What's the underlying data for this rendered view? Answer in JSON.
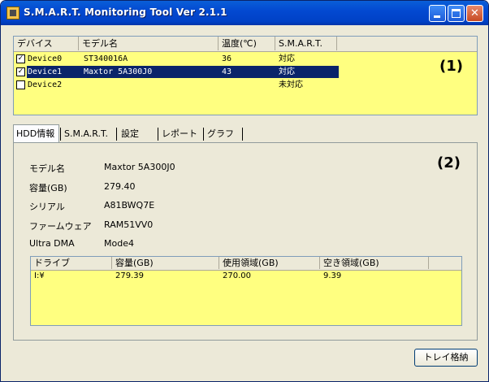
{
  "window": {
    "title": "S.M.A.R.T. Monitoring Tool  Ver 2.1.1",
    "minimize_glyph": "",
    "maximize_glyph": "",
    "close_glyph": "✕"
  },
  "device_list": {
    "columns": [
      "デバイス",
      "モデル名",
      "温度(℃)",
      "S.M.A.R.T."
    ],
    "rows": [
      {
        "checked": true,
        "device": "Device0",
        "model": "ST340016A",
        "temp": "36",
        "smart": "対応",
        "selected": false
      },
      {
        "checked": true,
        "device": "Device1",
        "model": "Maxtor 5A300J0",
        "temp": "43",
        "smart": "対応",
        "selected": true
      },
      {
        "checked": false,
        "device": "Device2",
        "model": "",
        "temp": "",
        "smart": "未対応",
        "selected": false
      }
    ],
    "marker": "(1)"
  },
  "tabs": [
    "HDD情報",
    "S.M.A.R.T.",
    "設定",
    "レポート",
    "グラフ"
  ],
  "hdd_info": {
    "marker": "(2)",
    "fields": [
      {
        "label": "モデル名",
        "value": "Maxtor 5A300J0"
      },
      {
        "label": "容量(GB)",
        "value": "279.40"
      },
      {
        "label": "シリアル",
        "value": "A81BWQ7E"
      },
      {
        "label": "ファームウェア",
        "value": "RAM51VV0"
      },
      {
        "label": "Ultra DMA",
        "value": "Mode4"
      }
    ],
    "drives": {
      "columns": [
        "ドライブ",
        "容量(GB)",
        "使用領域(GB)",
        "空き領域(GB)"
      ],
      "rows": [
        {
          "drive": "I:¥",
          "capacity": "279.39",
          "used": "270.00",
          "free": "9.39"
        }
      ]
    }
  },
  "tray_button": "トレイ格納",
  "colors": {
    "list_bg": "#ffff80",
    "selection": "#0a246a",
    "titlebar": "#0349d1"
  }
}
